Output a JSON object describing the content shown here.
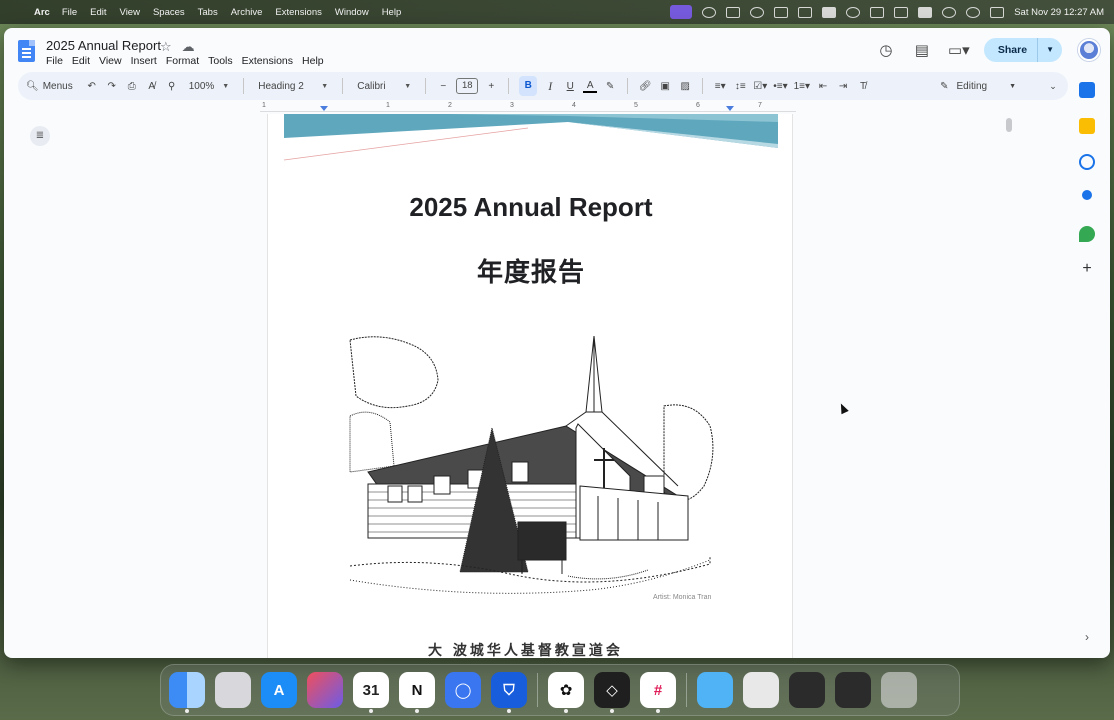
{
  "menubar": {
    "app_name": "Arc",
    "items": [
      "File",
      "Edit",
      "View",
      "Spaces",
      "Tabs",
      "Archive",
      "Extensions",
      "Window",
      "Help"
    ],
    "datetime": "Sat Nov 29  12:27 AM"
  },
  "docs": {
    "title": "2025 Annual Report",
    "menus": [
      "File",
      "Edit",
      "View",
      "Insert",
      "Format",
      "Tools",
      "Extensions",
      "Help"
    ],
    "share_label": "Share"
  },
  "toolbar": {
    "menus_label": "Menus",
    "zoom": "100%",
    "style": "Heading 2",
    "font": "Calibri",
    "font_size": "18",
    "mode": "Editing"
  },
  "ruler": [
    "1",
    "1",
    "2",
    "3",
    "4",
    "5",
    "6",
    "7"
  ],
  "document": {
    "heading": "2025 Annual Report",
    "heading_cn": "年度报告",
    "image_credit": "Artist: Monica Tran",
    "footer_cn": "大  波城华人基督教宣道会"
  },
  "dock": [
    "Finder",
    "Launchpad",
    "App Store",
    "Affinity",
    "Calendar",
    "Notion",
    "Signal",
    "Bitwarden",
    "ChatGPT",
    "Layers",
    "Slack",
    "Files",
    "Desktop",
    "Screens",
    "Window",
    "Trash"
  ],
  "colors": {
    "accent": "#4285f4",
    "share": "#c2e7ff",
    "banner": "#5fa7bd"
  }
}
